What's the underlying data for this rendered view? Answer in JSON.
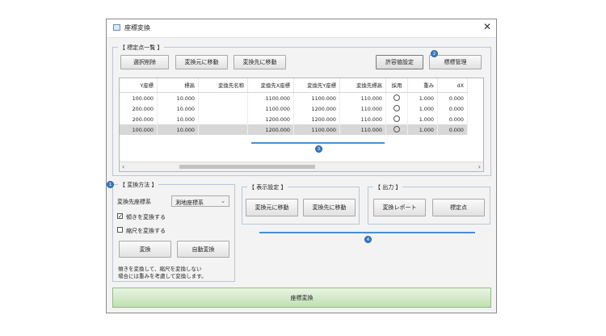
{
  "window": {
    "title": "座標変換",
    "close_glyph": "✕",
    "icon": "window-icon"
  },
  "points_group": {
    "legend": "【 標定点一覧 】",
    "buttons": {
      "deselect": "選択削除",
      "move_to_source": "変換元に移動",
      "move_to_target": "変換先に移動",
      "tolerance_setting": "許容値設定",
      "control_manage": "標標管理"
    },
    "columns": [
      "Y座標",
      "標高",
      "変換先名称",
      "変換先X座標",
      "変換先Y座標",
      "変換先標高",
      "採用",
      "重み",
      "dX"
    ],
    "rows": [
      [
        "100.000",
        "10.000",
        "",
        "1100.000",
        "1100.000",
        "110.000",
        "",
        "1.000",
        "0.000"
      ],
      [
        "200.000",
        "10.000",
        "",
        "1100.000",
        "1200.000",
        "110.000",
        "",
        "1.000",
        "0.000"
      ],
      [
        "200.000",
        "10.000",
        "",
        "1200.000",
        "1200.000",
        "110.000",
        "",
        "1.000",
        "0.000"
      ],
      [
        "100.000",
        "10.000",
        "",
        "1200.000",
        "1100.000",
        "110.000",
        "",
        "1.000",
        "0.000"
      ]
    ],
    "selected_row": 3,
    "scroll_left": "‹",
    "scroll_right": "›"
  },
  "method_group": {
    "legend": "【 変換方法 】",
    "target_crs_label": "変換先座標系",
    "target_crs_value": "測地座標系",
    "chk_rotate_label": "傾きを変換する",
    "chk_rotate_checked": true,
    "chk_scale_label": "縮尺を変換する",
    "chk_scale_checked": false,
    "btn_convert": "変換",
    "btn_auto_convert": "自動変換",
    "note_line1": "傾きを変換して、縮尺を変換しない",
    "note_line2": "場合には重みを考慮して変換します。"
  },
  "display_group": {
    "legend": "【 表示設定 】",
    "btn_move_source": "変換元に移動",
    "btn_move_target": "変換先に移動"
  },
  "output_group": {
    "legend": "【 出力 】",
    "btn_report": "変換レポート",
    "btn_control": "標定点"
  },
  "bottom_button": "座標変換",
  "markers": {
    "accent": "#3a7dc4",
    "m1": "1",
    "m2": "2",
    "m3": "3",
    "m4": "4"
  }
}
